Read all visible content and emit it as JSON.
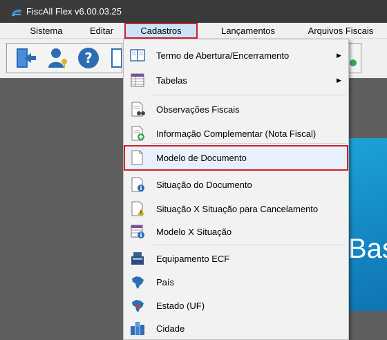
{
  "window": {
    "title": "FiscAll Flex v6.00.03.25"
  },
  "menubar": {
    "items": [
      {
        "label": "Sistema"
      },
      {
        "label": "Editar"
      },
      {
        "label": "Cadastros"
      },
      {
        "label": "Lançamentos"
      },
      {
        "label": "Arquivos Fiscais"
      }
    ]
  },
  "toolbar": {
    "buttons": [
      {
        "icon": "exit-icon"
      },
      {
        "icon": "users-key-icon"
      },
      {
        "icon": "help-icon"
      }
    ]
  },
  "dropdown": {
    "items": [
      {
        "label": "Termo de Abertura/Encerramento",
        "icon": "book-icon",
        "submenu": true
      },
      {
        "label": "Tabelas",
        "icon": "table-icon",
        "submenu": true
      },
      {
        "label": "Observações Fiscais",
        "icon": "document-binoculars-icon"
      },
      {
        "label": "Informação Complementar (Nota Fiscal)",
        "icon": "document-add-icon"
      },
      {
        "label": "Modelo de Documento",
        "icon": "blank-document-icon",
        "highlighted": true
      },
      {
        "label": "Situação do Documento",
        "icon": "document-info-icon"
      },
      {
        "label": "Situação X Situação para Cancelamento",
        "icon": "document-warning-icon"
      },
      {
        "label": "Modelo X Situação",
        "icon": "table-info-icon"
      },
      {
        "label": "Equipamento ECF",
        "icon": "cash-register-icon"
      },
      {
        "label": "País",
        "icon": "brazil-map-icon"
      },
      {
        "label": "Estado (UF)",
        "icon": "brazil-state-map-icon"
      },
      {
        "label": "Cidade",
        "icon": "city-icon"
      }
    ],
    "submenu_arrow": "▶"
  },
  "background": {
    "banner_text": "Bas"
  },
  "colors": {
    "titlebar": "#3a3a3a",
    "highlight_border": "#d0202a",
    "menu_active_bg": "#cce4f7",
    "workspace": "#5f5f5f",
    "banner": "#1488c4"
  }
}
